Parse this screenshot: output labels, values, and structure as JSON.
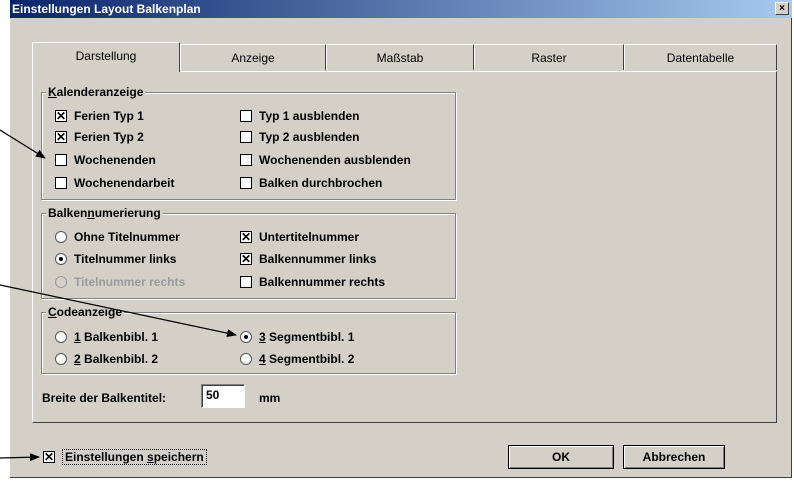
{
  "window": {
    "title": "Einstellungen Layout Balkenplan",
    "close_glyph": "×"
  },
  "tabs": [
    {
      "label": "Darstellung",
      "active": true
    },
    {
      "label": "Anzeige"
    },
    {
      "label": "Maßstab"
    },
    {
      "label": "Raster"
    },
    {
      "label": "Datentabelle"
    }
  ],
  "kalender": {
    "title_first": "K",
    "title_rest": "alenderanzeige",
    "items": [
      {
        "label": "Ferien Typ 1",
        "checked": true
      },
      {
        "label": "Ferien Typ 2",
        "checked": true
      },
      {
        "label": "Wochenenden",
        "checked": false
      },
      {
        "label": "Wochenendarbeit",
        "checked": false
      },
      {
        "label": "Typ 1 ausblenden",
        "checked": false
      },
      {
        "label": "Typ 2 ausblenden",
        "checked": false
      },
      {
        "label": "Wochenenden ausblenden",
        "checked": false
      },
      {
        "label": "Balken durchbrochen",
        "checked": false
      }
    ]
  },
  "balkennum": {
    "title_a": "Balken",
    "title_u": "n",
    "title_b": "umerierung",
    "radios": [
      {
        "label": "Ohne Titelnummer",
        "selected": false
      },
      {
        "label": "Titelnummer links",
        "selected": true
      },
      {
        "label": "Titelnummer rechts",
        "selected": false,
        "disabled": true
      }
    ],
    "checks": [
      {
        "label": "Untertitelnummer",
        "checked": true
      },
      {
        "label": "Balkennummer links",
        "checked": true
      },
      {
        "label": "Balkennummer rechts",
        "checked": false
      }
    ]
  },
  "code": {
    "title_first": "C",
    "title_rest": "odeanzeige",
    "items": [
      {
        "num": "1",
        "label": " Balkenbibl. 1",
        "selected": false
      },
      {
        "num": "2",
        "label": " Balkenbibl. 2",
        "selected": false
      },
      {
        "num": "3",
        "label": " Segmentbibl. 1",
        "selected": true
      },
      {
        "num": "4",
        "label": " Segmentbibl. 2",
        "selected": false
      }
    ]
  },
  "breite": {
    "label": "Breite der Balkentitel:",
    "value": "50",
    "unit": "mm"
  },
  "footer": {
    "save_a": "Einstellungen ",
    "save_u": "s",
    "save_b": "peichern",
    "save_checked": true,
    "ok_label": "OK",
    "cancel_label": "Abbrechen"
  },
  "glyphs": {
    "check": "✕"
  }
}
